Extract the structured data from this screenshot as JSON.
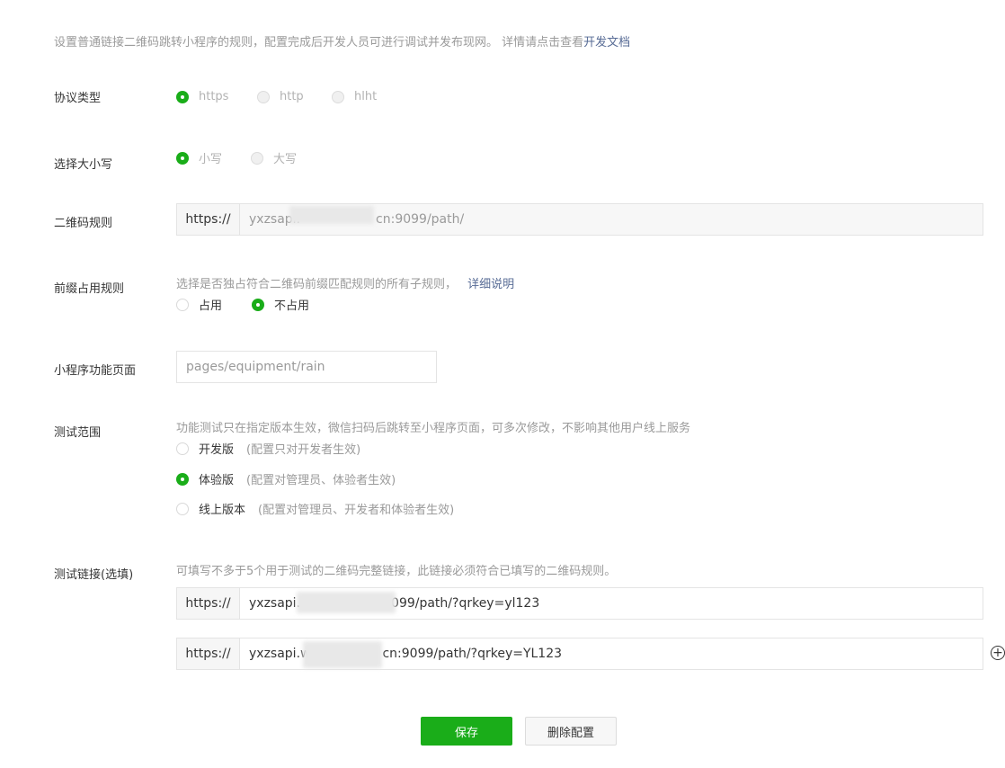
{
  "intro": {
    "text": "设置普通链接二维码跳转小程序的规则，配置完成后开发人员可进行调试并发布现网。 详情请点击查看",
    "link": "开发文档"
  },
  "protocol": {
    "label": "协议类型",
    "options": [
      {
        "label": "https",
        "checked": true
      },
      {
        "label": "http",
        "checked": false
      },
      {
        "label": "hlht",
        "checked": false
      }
    ]
  },
  "case": {
    "label": "选择大小写",
    "options": [
      {
        "label": "小写",
        "checked": true
      },
      {
        "label": "大写",
        "checked": false
      }
    ]
  },
  "qr_rule": {
    "label": "二维码规则",
    "prefix": "https://",
    "value_start": "yxzsapi.",
    "value_end": "cn:9099/path/"
  },
  "prefix_rule": {
    "label": "前缀占用规则",
    "hint": "选择是否独占符合二维码前缀匹配规则的所有子规则，",
    "hint_link": "详细说明",
    "options": [
      {
        "label": "占用",
        "checked": false
      },
      {
        "label": "不占用",
        "checked": true
      }
    ]
  },
  "page": {
    "label": "小程序功能页面",
    "value": "pages/equipment/rain"
  },
  "test_scope": {
    "label": "测试范围",
    "hint": "功能测试只在指定版本生效，微信扫码后跳转至小程序页面，可多次修改，不影响其他用户线上服务",
    "options": [
      {
        "label": "开发版",
        "sub": "(配置只对开发者生效)",
        "checked": false
      },
      {
        "label": "体验版",
        "sub": "(配置对管理员、体验者生效)",
        "checked": true
      },
      {
        "label": "线上版本",
        "sub": "(配置对管理员、开发者和体验者生效)",
        "checked": false
      }
    ]
  },
  "test_links": {
    "label": "测试链接(选填)",
    "hint": "可填写不多于5个用于测试的二维码完整链接，此链接必须符合已填写的二维码规则。",
    "prefix": "https://",
    "links": [
      {
        "start": "yxzsapi.",
        "end": "099/path/?qrkey=yl123"
      },
      {
        "start": "yxzsapi.w",
        "end": "cn:9099/path/?qrkey=YL123"
      }
    ],
    "add_symbol": "+"
  },
  "actions": {
    "save": "保存",
    "delete": "删除配置"
  },
  "colors": {
    "accent": "#1aad19",
    "link": "#576b95"
  }
}
